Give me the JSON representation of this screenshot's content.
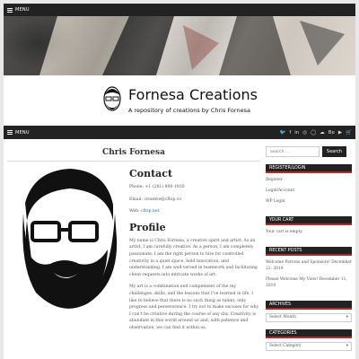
{
  "top_menu": {
    "label": "MENU"
  },
  "site": {
    "title": "Fornesa Creations",
    "description": "A repository of creations by Chris Fornesa"
  },
  "nav": {
    "menu_label": "MENU",
    "social_icons": [
      "twitter-icon",
      "facebook-icon",
      "linkedin-icon",
      "instagram-icon",
      "github-icon",
      "soundcloud-icon",
      "behance-icon",
      "youtube-icon",
      "store-icon"
    ],
    "social_glyphs": [
      "🐦",
      "f",
      "in",
      "◎",
      "◯",
      "☁",
      "Be",
      "▶",
      "🛒"
    ]
  },
  "post": {
    "title": "Chris Fornesa",
    "contact_heading": "Contact",
    "phone": "Phone: +1 (281) 800-1920",
    "email": "Email: creative@cftsp.co",
    "web_prefix": "Web: ",
    "web_link": "cftsp.net",
    "profile_heading": "Profile",
    "profile_p1": "My name is Chris Fornesa, a creative spirit and artist. As an artist, I am carefully creative. As a person, I am completely passionate. I am the right person to hire for controlled creativity in a quiet space, bold innovation, and understanding. I am well-versed in teamwork and facilitating client requests into intricate works of art.",
    "profile_p2": "My art is a combination and complement of the my challenges, skills, and the lessons that I've learned in life. I like to believe that there is no such thing as talent, only progress and perseverence. I try not to make excuses for why I can't be creative during the course of any day. Creativity is abundant in this world around us and, with patience and observation, we can find it within us."
  },
  "sidebar": {
    "search_placeholder": "Search …",
    "search_button": "Search",
    "register_title": "REGISTER/LOGIN",
    "register_links": [
      "Register",
      "Login/Account",
      "WP Login"
    ],
    "cart_title": "YOUR CART",
    "cart_text": "Your cart is empty.",
    "recent_title": "RECENT POSTS",
    "recent_posts": [
      {
        "title": "Welcome Patrons and Sponsors!",
        "date": "December 21, 2019"
      },
      {
        "title": "Please Welcome My View!",
        "date": "December 11, 2019"
      }
    ],
    "archives_title": "ARCHIVES",
    "archives_select": "Select Month",
    "categories_title": "CATEGORIES",
    "categories_select": "Select Category"
  },
  "colors": {
    "accent": "#b52a2a",
    "dark": "#222222",
    "link": "#3366aa"
  }
}
